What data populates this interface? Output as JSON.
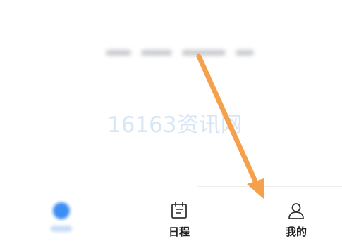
{
  "watermark": "16163资讯网",
  "tabbar": {
    "tabs": [
      {
        "id": "home",
        "label": "",
        "icon": "home-icon",
        "active": true
      },
      {
        "id": "schedule",
        "label": "日程",
        "icon": "calendar-icon",
        "active": false
      },
      {
        "id": "mine",
        "label": "我的",
        "icon": "person-icon",
        "active": false
      }
    ]
  },
  "colors": {
    "accent": "#3b8ef3",
    "annotation_arrow": "#f5a04a",
    "watermark": "#c9def3"
  }
}
